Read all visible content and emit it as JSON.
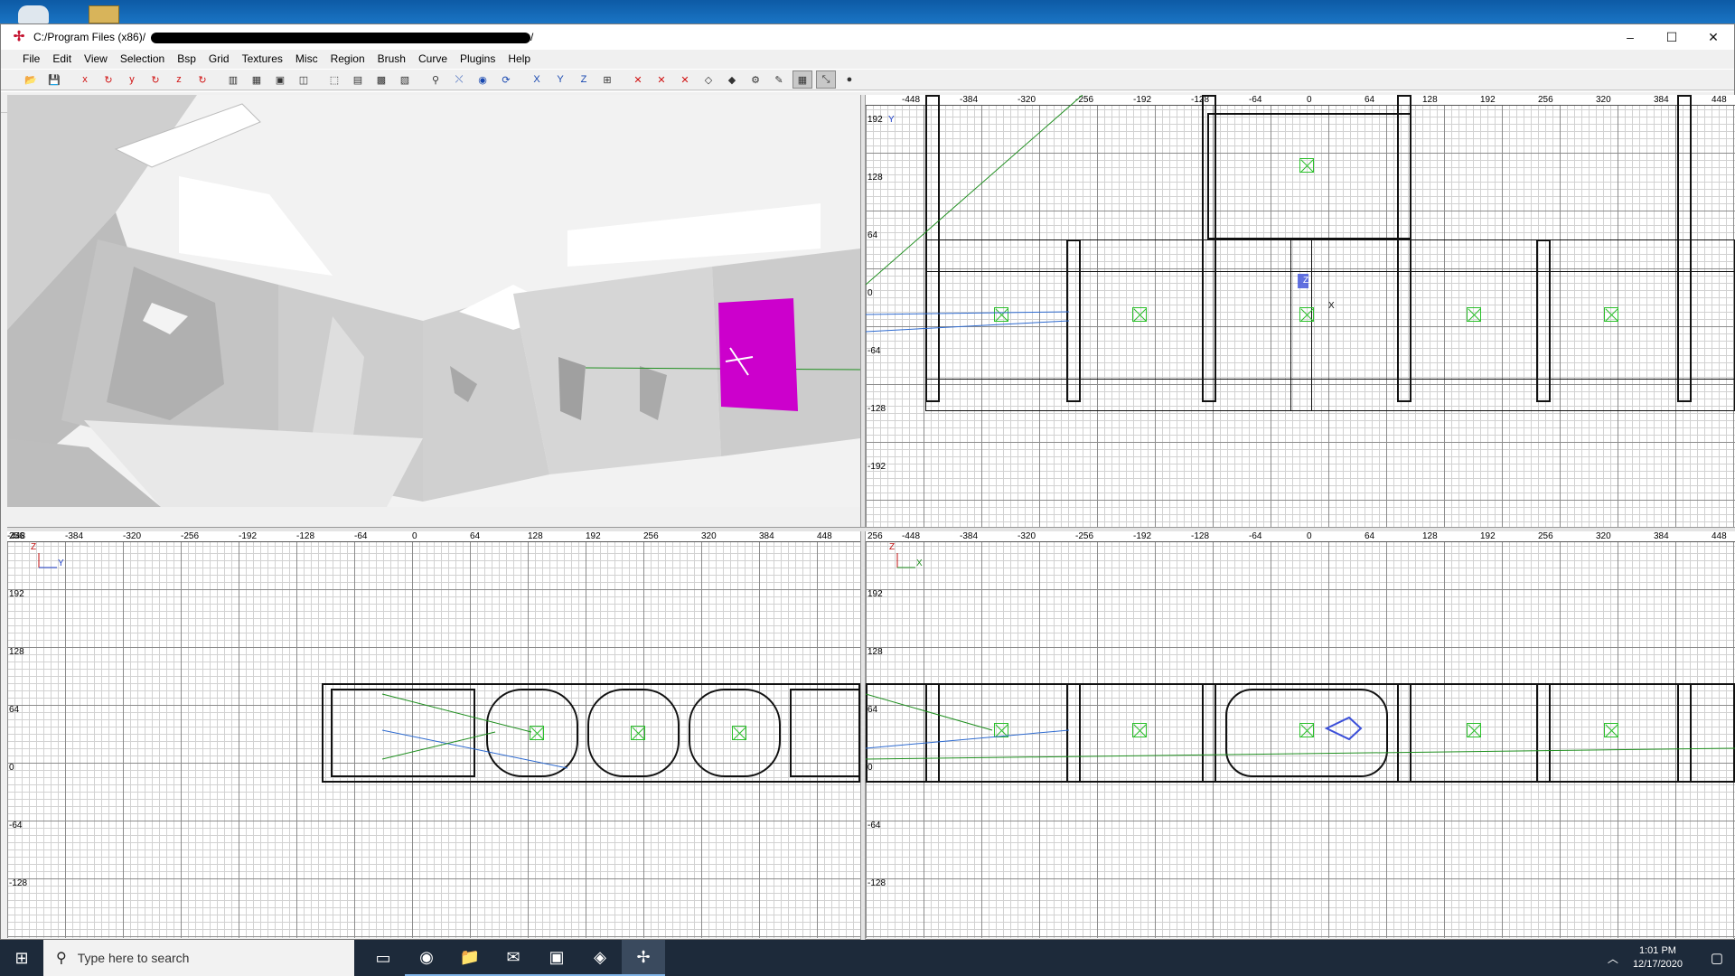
{
  "window": {
    "title": "C:/Program Files (x86)/",
    "title_end": "/",
    "controls": {
      "minimize": "–",
      "maximize": "☐",
      "close": "✕"
    }
  },
  "menu": [
    "File",
    "Edit",
    "View",
    "Selection",
    "Bsp",
    "Grid",
    "Textures",
    "Misc",
    "Region",
    "Brush",
    "Curve",
    "Plugins",
    "Help"
  ],
  "toolbar1": [
    {
      "icon": "open-icon",
      "glyph": "📂"
    },
    {
      "icon": "save-icon",
      "glyph": "💾"
    },
    {
      "icon": "flip-x-icon",
      "glyph": "x"
    },
    {
      "icon": "rotate-x-icon",
      "glyph": "↻"
    },
    {
      "icon": "flip-y-icon",
      "glyph": "y"
    },
    {
      "icon": "rotate-y-icon",
      "glyph": "↻"
    },
    {
      "icon": "flip-z-icon",
      "glyph": "z"
    },
    {
      "icon": "rotate-z-icon",
      "glyph": "↻"
    },
    {
      "icon": "csg-subtract-icon",
      "glyph": "▥"
    },
    {
      "icon": "csg-merge-icon",
      "glyph": "▦"
    },
    {
      "icon": "hollow-icon",
      "glyph": "▣"
    },
    {
      "icon": "clip-icon",
      "glyph": "◫"
    },
    {
      "icon": "select-touching-icon",
      "glyph": "⬚"
    },
    {
      "icon": "select-inside-icon",
      "glyph": "▤"
    },
    {
      "icon": "select-complete-icon",
      "glyph": "▩"
    },
    {
      "icon": "select-partial-icon",
      "glyph": "▧"
    },
    {
      "icon": "texture-lock-icon",
      "glyph": "⚲"
    },
    {
      "icon": "change-view-icon",
      "glyph": "⤬"
    },
    {
      "icon": "camera-icon",
      "glyph": "◉"
    },
    {
      "icon": "refresh-icon",
      "glyph": "⟳"
    },
    {
      "icon": "view-x-icon",
      "glyph": "X"
    },
    {
      "icon": "view-y-icon",
      "glyph": "Y"
    },
    {
      "icon": "view-z-icon",
      "glyph": "Z"
    },
    {
      "icon": "cube-clip-icon",
      "glyph": "⊞"
    },
    {
      "icon": "sel-x-icon",
      "glyph": "✕"
    },
    {
      "icon": "sel-y-icon",
      "glyph": "✕"
    },
    {
      "icon": "sel-z-icon",
      "glyph": "✕"
    },
    {
      "icon": "drag-edge-icon",
      "glyph": "◇"
    },
    {
      "icon": "drag-vertex-icon",
      "glyph": "◆"
    },
    {
      "icon": "entity-icon",
      "glyph": "⚙"
    },
    {
      "icon": "brush-icon",
      "glyph": "✎"
    },
    {
      "icon": "patch-icon",
      "glyph": "▦"
    },
    {
      "icon": "patch-bend-icon",
      "glyph": "⤡"
    },
    {
      "icon": "plugin-icon",
      "glyph": "●"
    }
  ],
  "toolbar2": [
    {
      "icon": "curve-cylinder-icon",
      "glyph": "◎"
    },
    {
      "icon": "curve-bevel-icon",
      "glyph": "▦"
    },
    {
      "icon": "curve-endcap-icon",
      "glyph": "▦"
    },
    {
      "icon": "curve-cone-icon",
      "glyph": "▦"
    },
    {
      "icon": "curve-matrix-icon",
      "glyph": "▤"
    },
    {
      "icon": "curve-cycle-icon",
      "glyph": "⟳"
    },
    {
      "icon": "curve-sphere-icon",
      "glyph": "○"
    },
    {
      "icon": "curve-thicken-icon",
      "glyph": "▨"
    },
    {
      "icon": "curve-cap-icon",
      "glyph": "✿"
    },
    {
      "icon": "curve-bug-icon",
      "glyph": "✱"
    },
    {
      "icon": "curve-insert-icon",
      "glyph": "⬇"
    },
    {
      "icon": "curve-delete-icon",
      "glyph": "⧓"
    },
    {
      "icon": "curve-redisperse-icon",
      "glyph": "⧒"
    },
    {
      "icon": "curve-matrix-transpose-icon",
      "glyph": "⊠"
    },
    {
      "icon": "curve-overlay-icon",
      "glyph": "⊟"
    }
  ],
  "top_view": {
    "x_ticks": [
      "-448",
      "-384",
      "-320",
      "-256",
      "-192",
      "-128",
      "-64",
      "0",
      "64",
      "128",
      "192",
      "256",
      "320",
      "384",
      "448"
    ],
    "y_ticks": [
      "192",
      "128",
      "64",
      "0",
      "-64",
      "-128",
      "-192"
    ],
    "axis_labels": [
      "Y",
      "X",
      "Z"
    ]
  },
  "side_view": {
    "x_ticks": [
      "-448",
      "-384",
      "-320",
      "-256",
      "-192",
      "-128",
      "-64",
      "0",
      "64",
      "128",
      "192",
      "256",
      "320",
      "384",
      "448"
    ],
    "y_ticks": [
      "256",
      "192",
      "128",
      "64",
      "0",
      "-64",
      "-128"
    ],
    "axis_labels": [
      "Z",
      "Y"
    ]
  },
  "front_view": {
    "x_ticks": [
      "-448",
      "-384",
      "-320",
      "-256",
      "-192",
      "-128",
      "-64",
      "0",
      "64",
      "128",
      "192",
      "256",
      "320",
      "384",
      "448"
    ],
    "y_ticks": [
      "256",
      "192",
      "128",
      "64",
      "0",
      "-64",
      "-128"
    ],
    "axis_labels": [
      "Z",
      "X"
    ]
  },
  "taskbar": {
    "search_placeholder": "Type here to search",
    "time": "1:01 PM",
    "date": "12/17/2020",
    "apps": [
      {
        "name": "task-view-icon",
        "glyph": "▭"
      },
      {
        "name": "chrome-icon",
        "glyph": "◉"
      },
      {
        "name": "file-explorer-icon",
        "glyph": "📁"
      },
      {
        "name": "mail-icon",
        "glyph": "✉"
      },
      {
        "name": "windows-app-icon",
        "glyph": "▣"
      },
      {
        "name": "game-launcher-icon",
        "glyph": "◈"
      },
      {
        "name": "radiant-editor-icon",
        "glyph": "✢"
      }
    ]
  }
}
